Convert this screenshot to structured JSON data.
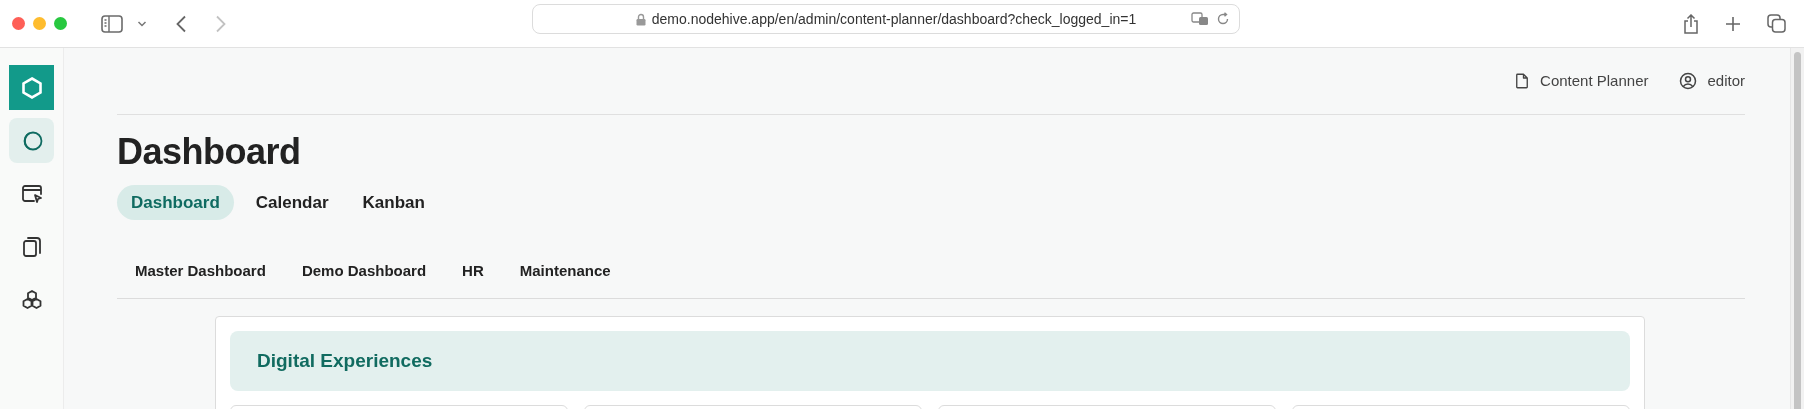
{
  "browser": {
    "url": "demo.nodehive.app/en/admin/content-planner/dashboard?check_logged_in=1"
  },
  "sidebar": {
    "items": [
      {
        "kind": "logo",
        "selected": false
      },
      {
        "kind": "spaces",
        "selected": true
      },
      {
        "kind": "pages",
        "selected": false
      },
      {
        "kind": "documents",
        "selected": false
      },
      {
        "kind": "modules",
        "selected": false
      }
    ]
  },
  "header_links": [
    {
      "kind": "document",
      "label": "Content Planner"
    },
    {
      "kind": "user",
      "label": "editor"
    }
  ],
  "title": "Dashboard",
  "tabs": [
    {
      "label": "Dashboard",
      "selected": true
    },
    {
      "label": "Calendar",
      "selected": false
    },
    {
      "label": "Kanban",
      "selected": false
    }
  ],
  "subtabs": [
    "Master Dashboard",
    "Demo Dashboard",
    "HR",
    "Maintenance"
  ],
  "section": {
    "title": "Digital Experiences"
  }
}
